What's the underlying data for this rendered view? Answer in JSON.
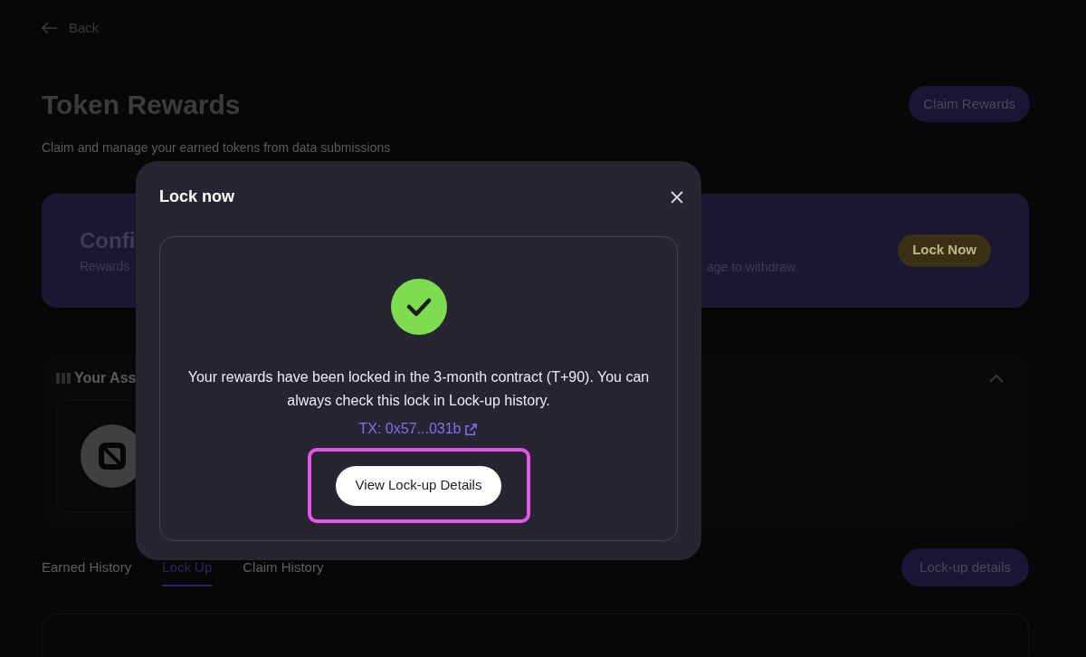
{
  "back": {
    "label": "Back"
  },
  "header": {
    "title": "Token Rewards",
    "subtitle": "Claim and manage your earned tokens from data submissions",
    "claim_button": "Claim Rewards"
  },
  "banner": {
    "title": "Confi",
    "subtitle_start": "Rewards",
    "subtitle_end": "age to withdraw.",
    "button": "Lock Now"
  },
  "assets": {
    "title": "Your Ass",
    "expanded": true
  },
  "tabs": [
    {
      "label": "Earned History",
      "selected": false
    },
    {
      "label": "Lock Up",
      "selected": true
    },
    {
      "label": "Claim History",
      "selected": false
    }
  ],
  "lockup_button": "Lock-up details",
  "modal": {
    "title": "Lock now",
    "message": "Your rewards have been locked in the 3-month contract (T+90). You can always check this lock in Lock-up history.",
    "tx": "TX: 0x57...031b",
    "button": "View Lock-up Details",
    "highlighted": true
  }
}
